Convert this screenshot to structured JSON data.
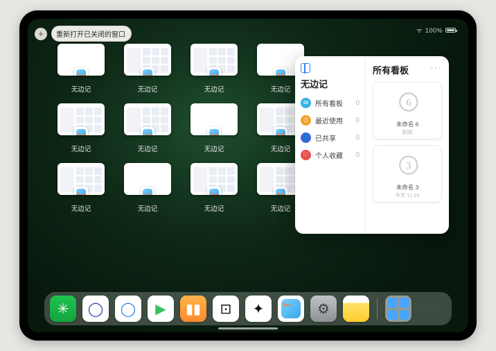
{
  "status": {
    "battery_pct": "100%"
  },
  "reopen": {
    "label": "重新打开已关闭的窗口",
    "plus": "+"
  },
  "app_name": "无边记",
  "window_tiles": [
    {
      "label": "无边记",
      "variant": "blank"
    },
    {
      "label": "无边记",
      "variant": "full"
    },
    {
      "label": "无边记",
      "variant": "full"
    },
    {
      "label": "无边记",
      "variant": "blank"
    },
    {
      "label": "无边记",
      "variant": "full"
    },
    {
      "label": "无边记",
      "variant": "full"
    },
    {
      "label": "无边记",
      "variant": "blank"
    },
    {
      "label": "无边记",
      "variant": "full"
    },
    {
      "label": "无边记",
      "variant": "full"
    },
    {
      "label": "无边记",
      "variant": "blank"
    },
    {
      "label": "无边记",
      "variant": "full"
    },
    {
      "label": "无边记",
      "variant": "full"
    }
  ],
  "preview": {
    "title_left": "无边记",
    "title_right": "所有看板",
    "more": "···",
    "categories": [
      {
        "icon_color": "ci-blue",
        "glyph": "✉",
        "label": "所有看板",
        "count": "0"
      },
      {
        "icon_color": "ci-orange",
        "glyph": "⏱",
        "label": "最近使用",
        "count": "0"
      },
      {
        "icon_color": "ci-purple",
        "glyph": "👤",
        "label": "已共享",
        "count": "0"
      },
      {
        "icon_color": "ci-red",
        "glyph": "♡",
        "label": "个人收藏",
        "count": "0"
      }
    ],
    "boards": [
      {
        "label": "未命名 6",
        "sub": "刚刚",
        "glyph": "6"
      },
      {
        "label": "未命名 3",
        "sub": "今天 11:29",
        "glyph": "3"
      }
    ]
  },
  "dock": [
    {
      "name": "wechat-icon",
      "bg": "linear-gradient(#1fc24e,#12a53e)",
      "glyph": "✳",
      "color": "#fff"
    },
    {
      "name": "quark-hd-icon",
      "bg": "#fff",
      "glyph": "◯",
      "color": "#2d3fb5"
    },
    {
      "name": "quark-icon",
      "bg": "#fff",
      "glyph": "◯",
      "color": "#2d7fe8"
    },
    {
      "name": "play-icon",
      "bg": "#fff",
      "glyph": "▶",
      "color": "#36c361"
    },
    {
      "name": "books-icon",
      "bg": "linear-gradient(#ffb24a,#ff8a2b)",
      "glyph": "▮▮",
      "color": "#fff"
    },
    {
      "name": "dice-icon",
      "bg": "#fff",
      "glyph": "⊡",
      "color": "#111"
    },
    {
      "name": "connect-icon",
      "bg": "#fff",
      "glyph": "✦",
      "color": "#111"
    },
    {
      "name": "freeform-icon",
      "bg": "#fff",
      "glyph": "",
      "color": "",
      "freeform": true
    },
    {
      "name": "settings-icon",
      "bg": "linear-gradient(#bfc3c7,#8d9195)",
      "glyph": "⚙",
      "color": "#3b3d40"
    },
    {
      "name": "notes-icon",
      "bg": "linear-gradient(#fff 0%,#fff 28%,#ffe16a 28%,#ffcd2e 100%)",
      "glyph": "",
      "color": ""
    }
  ]
}
